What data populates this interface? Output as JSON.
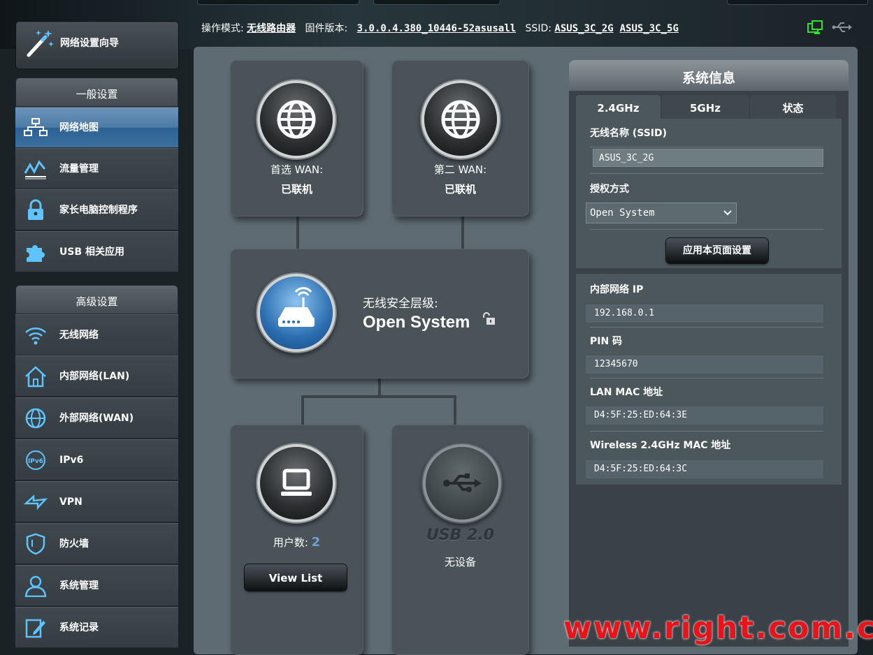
{
  "menu": {
    "wizard_label": "网络设置向导",
    "general_header": "一般设置",
    "general_items": [
      {
        "label": "网络地图"
      },
      {
        "label": "流量管理"
      },
      {
        "label": "家长电脑控制程序"
      },
      {
        "label": "USB 相关应用"
      }
    ],
    "advanced_header": "高级设置",
    "advanced_items": [
      {
        "label": "无线网络"
      },
      {
        "label": "内部网络(LAN)"
      },
      {
        "label": "外部网络(WAN)"
      },
      {
        "label": "IPv6"
      },
      {
        "label": "VPN"
      },
      {
        "label": "防火墙"
      },
      {
        "label": "系统管理"
      },
      {
        "label": "系统记录"
      }
    ]
  },
  "status": {
    "mode_label": "操作模式:",
    "mode_value": "无线路由器",
    "firmware_label": "固件版本:",
    "firmware_value": "3.0.0.4.380_10446-52asusall",
    "ssid_label": "SSID:",
    "ssid_2g": "ASUS_3C_2G",
    "ssid_5g": "ASUS_3C_5G"
  },
  "map": {
    "wan1_label": "首选 WAN:",
    "wan1_status": "已联机",
    "wan2_label": "第二 WAN:",
    "wan2_status": "已联机",
    "security_label": "无线安全层级:",
    "security_value": "Open System",
    "clients_label": "用户数:",
    "clients_count": "2",
    "view_list": "View List",
    "usb_version": "USB 2.0",
    "usb_status": "无设备"
  },
  "sysinfo": {
    "title": "系统信息",
    "tabs": [
      "2.4GHz",
      "5GHz",
      "状态"
    ],
    "ssid_label": "无线名称 (SSID)",
    "ssid_value": "ASUS_3C_2G",
    "auth_label": "授权方式",
    "auth_value": "Open System",
    "apply_label": "应用本页面设置",
    "lan_ip_label": "内部网络 IP",
    "lan_ip_value": "192.168.0.1",
    "pin_label": "PIN 码",
    "pin_value": "12345670",
    "lan_mac_label": "LAN MAC 地址",
    "lan_mac_value": "D4:5F:25:ED:64:3E",
    "wl_mac_label": "Wireless 2.4GHz MAC 地址",
    "wl_mac_value": "D4:5F:25:ED:64:3C"
  },
  "watermark": "www.right.com.cn",
  "colors": {
    "accent": "#4b7ba6",
    "panel": "#5e6b72",
    "card": "#4a5357",
    "count": "#6aa3d8",
    "watermark": "#e8141c"
  }
}
